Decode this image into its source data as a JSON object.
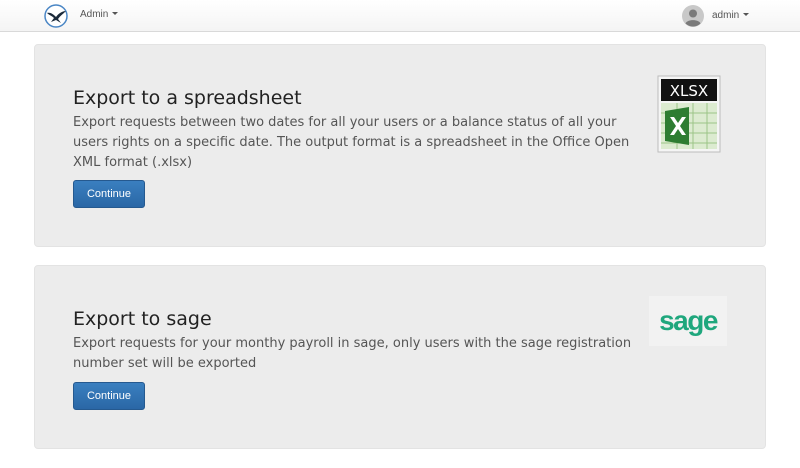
{
  "navbar": {
    "admin_label": "Admin",
    "user_label": "admin"
  },
  "panels": [
    {
      "title": "Export to a spreadsheet",
      "description": "Export requests between two dates for all your users or a balance status of all your users rights on a specific date. The output format is a spreadsheet in the Office Open XML format (.xlsx)",
      "button_label": "Continue",
      "icon_text": "XLSX"
    },
    {
      "title": "Export to sage",
      "description": "Export requests for your monthy payroll in sage, only users with the sage registration number set will be exported",
      "button_label": "Continue",
      "logo_text": "sage"
    }
  ],
  "colors": {
    "button": "#2f72b5",
    "panel_bg": "#ececec",
    "sage_green": "#1fa77d",
    "excel_green": "#3f8f2f"
  }
}
